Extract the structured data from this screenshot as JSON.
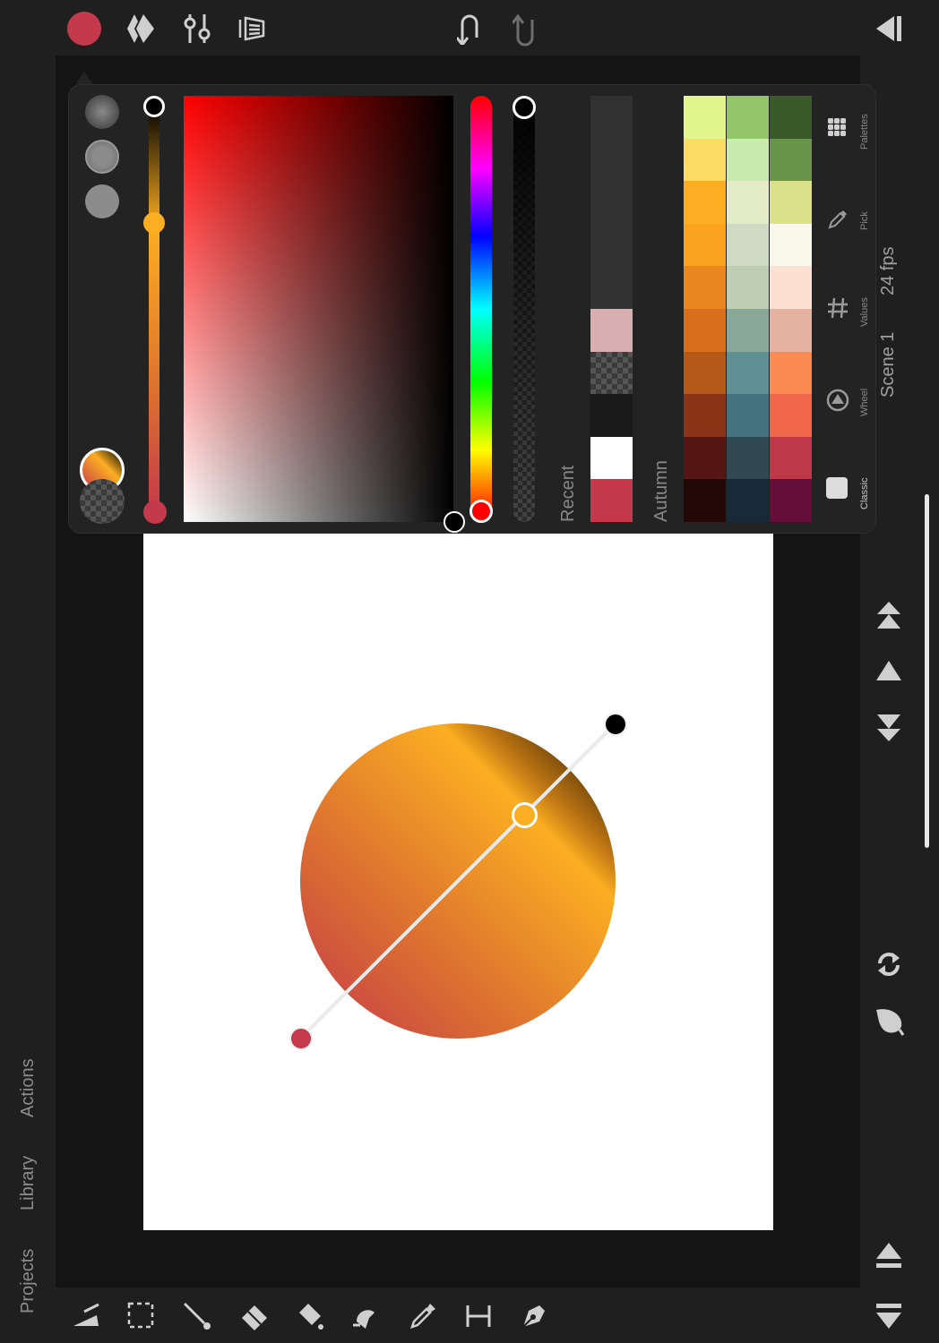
{
  "toolbar": {
    "current_color": "#c4394b",
    "icons": [
      "color-swatch-button",
      "keyframes-icon",
      "adjustments-icon",
      "onion-skin-icon",
      "undo-icon",
      "redo-icon",
      "collapse-panel-icon"
    ]
  },
  "left_sidebar": {
    "actions_label": "Actions",
    "library_label": "Library",
    "projects_label": "Projects"
  },
  "right_sidebar": {
    "scene_label": "Scene 1",
    "fps_label": "24 fps"
  },
  "color_picker": {
    "mode_tabs": [
      {
        "label": "Palettes"
      },
      {
        "label": "Pick"
      },
      {
        "label": "Values"
      },
      {
        "label": "Wheel"
      },
      {
        "label": "Classic"
      }
    ],
    "recent_label": "Recent",
    "palette_name": "Autumn",
    "selected_hue": "#ff0000",
    "gradient_start": "#c4394b",
    "gradient_end": "#000000",
    "recent_colors": [
      "#323232",
      "#323232",
      "#323232",
      "#323232",
      "#323232",
      "#d9aeb0",
      "checker",
      "#1a1a1a",
      "#ffffff",
      "#c4394b"
    ],
    "palette_columns": [
      [
        "#e2f48c",
        "#fcdc64",
        "#fbae22",
        "#fba31f",
        "#e9861f",
        "#d8701b",
        "#b45918",
        "#8a3418",
        "#561614",
        "#240707"
      ],
      [
        "#93c56a",
        "#c9ebad",
        "#e3ecc6",
        "#cfdac4",
        "#bfcdb2",
        "#89a899",
        "#5f9094",
        "#45727f",
        "#304952",
        "#182a37"
      ],
      [
        "#3b5a2a",
        "#6a944c",
        "#dbe18a",
        "#f9f7ea",
        "#fde0d2",
        "#e4b29e",
        "#fb8b53",
        "#f0674c",
        "#bd3848",
        "#650e3a"
      ]
    ]
  },
  "gradient_tool": {
    "start_color": "#c4394b",
    "end_color": "#000000",
    "midpoint_color": "#fbae22"
  },
  "bottom_tools": [
    "move-tool-icon",
    "selection-tool-icon",
    "brush-tool-icon",
    "eraser-tool-icon",
    "fill-tool-icon",
    "smudge-tool-icon",
    "eyedropper-tool-icon",
    "measure-tool-icon",
    "pen-tool-icon"
  ]
}
